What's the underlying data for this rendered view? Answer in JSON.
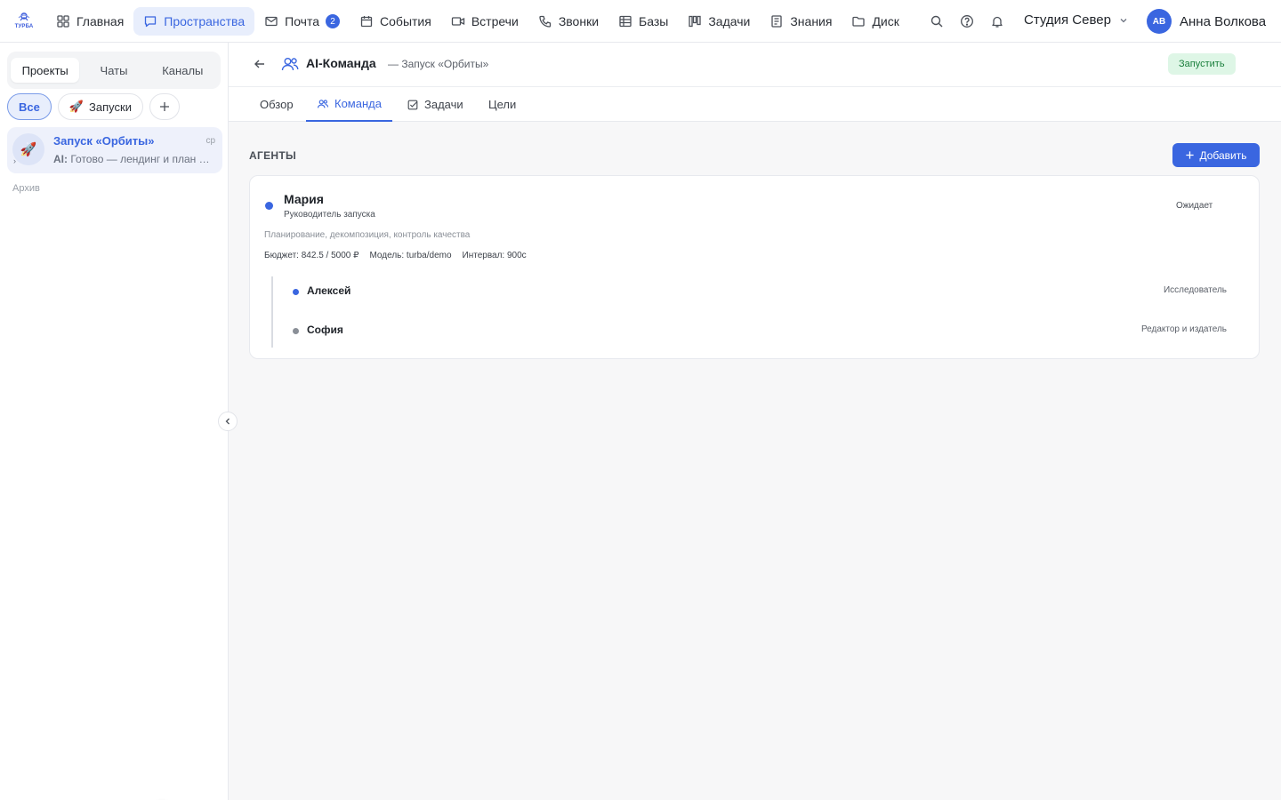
{
  "brand": {
    "logo_text": "ТУРБА"
  },
  "nav": {
    "items": [
      {
        "label": "Главная",
        "icon": "grid-icon"
      },
      {
        "label": "Пространства",
        "icon": "chat-icon",
        "active": true
      },
      {
        "label": "Почта",
        "icon": "mail-icon",
        "badge": "2"
      },
      {
        "label": "События",
        "icon": "calendar-icon"
      },
      {
        "label": "Встречи",
        "icon": "video-icon"
      },
      {
        "label": "Звонки",
        "icon": "phone-icon"
      },
      {
        "label": "Базы",
        "icon": "table-icon"
      },
      {
        "label": "Задачи",
        "icon": "kanban-icon"
      },
      {
        "label": "Знания",
        "icon": "book-icon"
      },
      {
        "label": "Диск",
        "icon": "folder-icon"
      }
    ]
  },
  "topbar": {
    "workspace": "Студия Север",
    "user": {
      "initials": "АВ",
      "name": "Анна Волкова"
    }
  },
  "sidebar": {
    "segments": [
      "Проекты",
      "Чаты",
      "Каналы"
    ],
    "filters": {
      "all": "Все",
      "launches": "Запуски",
      "launches_emoji": "🚀"
    },
    "project": {
      "emoji": "🚀",
      "title": "Запуск «Орбиты»",
      "time": "ср",
      "preview_prefix": "AI:",
      "preview": "Готово — лендинг и план …"
    },
    "archive_label": "Архив"
  },
  "header": {
    "title": "AI-Команда",
    "subtitle": "— Запуск «Орбиты»",
    "run_label": "Запустить"
  },
  "tabs": [
    {
      "label": "Обзор"
    },
    {
      "label": "Команда",
      "active": true
    },
    {
      "label": "Задачи"
    },
    {
      "label": "Цели"
    }
  ],
  "agents": {
    "section_title": "АГЕНТЫ",
    "add_label": "Добавить",
    "lead": {
      "name": "Мария",
      "role": "Руководитель запуска",
      "status": "Ожидает",
      "description": "Планирование, декомпозиция, контроль качества",
      "budget": "Бюджет: 842.5 / 5000 ₽",
      "model": "Модель: turba/demo",
      "interval": "Интервал: 900с"
    },
    "members": [
      {
        "name": "Алексей",
        "role": "Исследователь",
        "status_color": "#3a66e0"
      },
      {
        "name": "София",
        "role": "Редактор и издатель",
        "status_color": "#8a8f97"
      }
    ]
  },
  "colors": {
    "accent": "#3a66e0",
    "run_bg": "#def6e6",
    "run_text": "#1a7f3c"
  }
}
